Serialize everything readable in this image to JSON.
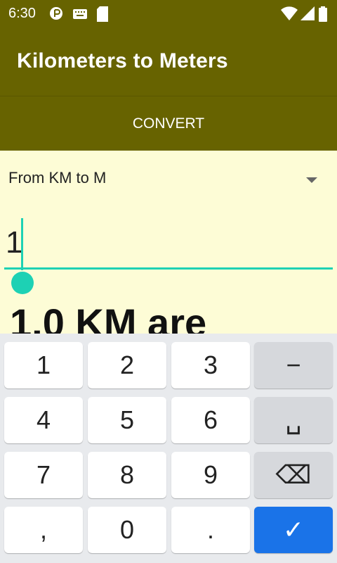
{
  "status": {
    "time": "6:30"
  },
  "app": {
    "title": "Kilometers to Meters"
  },
  "tabs": [
    {
      "label": "CONVERT"
    }
  ],
  "spinner": {
    "selected": "From KM to M"
  },
  "input": {
    "value": "1"
  },
  "result": {
    "text": "1.0 KM are"
  },
  "keyboard": {
    "keys": [
      "1",
      "2",
      "3",
      "−",
      "4",
      "5",
      "6",
      "␣",
      "7",
      "8",
      "9",
      "⌫",
      ",",
      "0",
      ".",
      "✓"
    ]
  },
  "colors": {
    "primary": "#676300",
    "background": "#FDFCD6",
    "accent": "#1DD1B4",
    "action": "#1A73E8"
  }
}
